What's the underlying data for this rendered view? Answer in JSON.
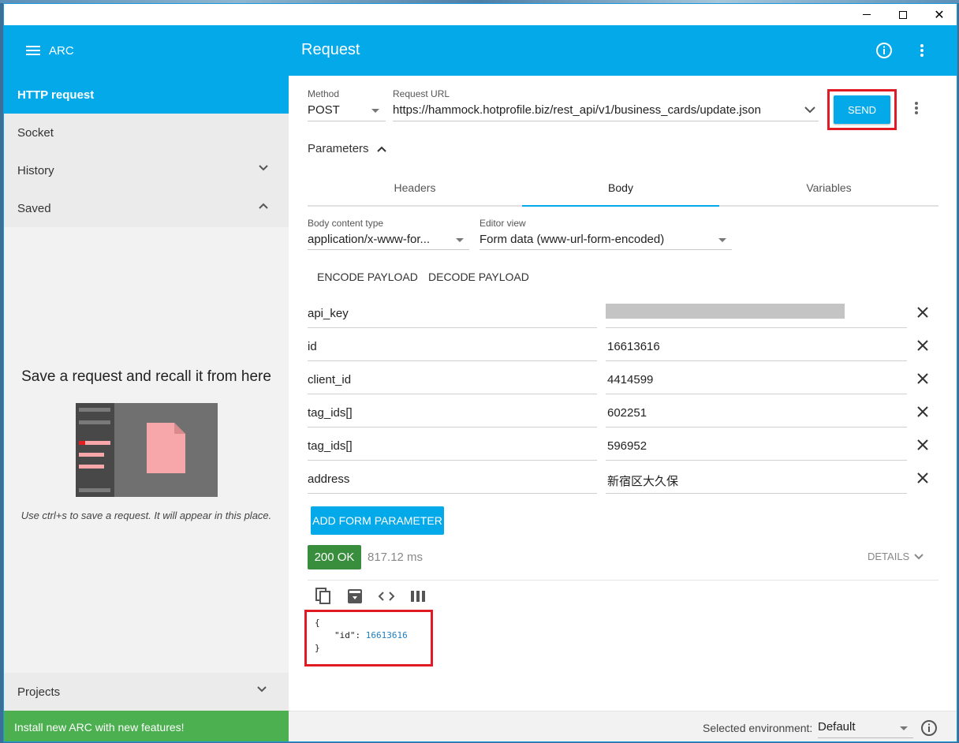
{
  "window": {
    "minimize_icon": "minimize-icon",
    "maximize_icon": "maximize-icon",
    "close_glyph": "✕"
  },
  "sidebar": {
    "app_name": "ARC",
    "items": [
      {
        "label": "HTTP request",
        "active": true
      },
      {
        "label": "Socket"
      },
      {
        "label": "History",
        "chevron": "down"
      },
      {
        "label": "Saved",
        "chevron": "up"
      }
    ],
    "saved_empty": {
      "title": "Save a request and recall it from here",
      "hint": "Use ctrl+s to save a request. It will appear in this place."
    },
    "projects_label": "Projects",
    "install_banner": "Install new ARC with new features!"
  },
  "main": {
    "title": "Request",
    "method": {
      "label": "Method",
      "value": "POST"
    },
    "url": {
      "label": "Request URL",
      "value": "https://hammock.hotprofile.biz/rest_api/v1/business_cards/update.json"
    },
    "send_label": "SEND",
    "parameters_label": "Parameters",
    "tabs": [
      {
        "label": "Headers"
      },
      {
        "label": "Body",
        "active": true
      },
      {
        "label": "Variables"
      }
    ],
    "body_content_type": {
      "label": "Body content type",
      "value": "application/x-www-for..."
    },
    "editor_view": {
      "label": "Editor view",
      "value": "Form data (www-url-form-encoded)"
    },
    "encode_label": "ENCODE PAYLOAD",
    "decode_label": "DECODE PAYLOAD",
    "params": [
      {
        "name": "api_key",
        "value": "",
        "redacted": true
      },
      {
        "name": "id",
        "value": "16613616"
      },
      {
        "name": "client_id",
        "value": "4414599"
      },
      {
        "name": "tag_ids[]",
        "value": "602251"
      },
      {
        "name": "tag_ids[]",
        "value": "596952"
      },
      {
        "name": "address",
        "value": "新宿区大久保"
      }
    ],
    "add_param_label": "ADD FORM PARAMETER",
    "response": {
      "status": "200 OK",
      "time": "817.12 ms",
      "details_label": "DETAILS",
      "json_open": "{",
      "json_key": "\"id\":",
      "json_value": "16613616",
      "json_close": "}"
    }
  },
  "footer": {
    "env_label": "Selected environment:",
    "env_value": "Default"
  },
  "colors": {
    "accent": "#03a9e8",
    "success": "#388e3c",
    "install": "#4caf50",
    "highlight": "#e01b24"
  }
}
